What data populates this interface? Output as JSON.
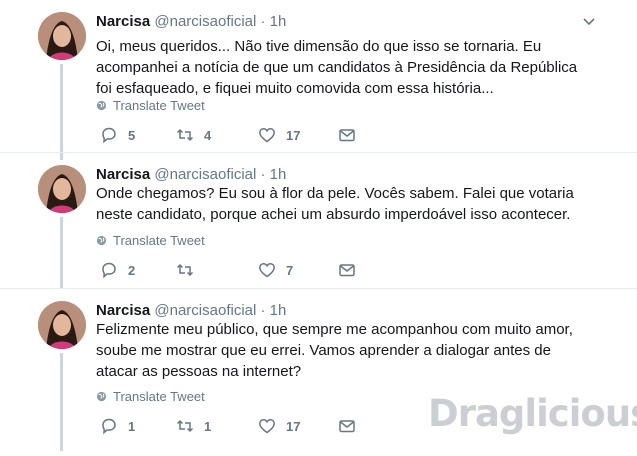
{
  "tweets": [
    {
      "name": "Narcisa",
      "handle": "@narcisaoficial",
      "dot": "·",
      "time": "1h",
      "text": "Oi, meus queridos... Não tive dimensão do que isso se tornaria. Eu acompanhei a notícia de que um candidatos à Presidência da República foi esfaqueado, e fiquei muito comovida com essa história...",
      "translate": "Translate Tweet",
      "replies": "5",
      "retweets": "4",
      "likes": "17"
    },
    {
      "name": "Narcisa",
      "handle": "@narcisaoficial",
      "dot": "·",
      "time": "1h",
      "text": "Onde chegamos? Eu sou à flor da pele. Vocês sabem. Falei que votaria neste candidato, porque achei um absurdo imperdoável isso acontecer.",
      "translate": "Translate Tweet",
      "replies": "2",
      "retweets": "",
      "likes": "7"
    },
    {
      "name": "Narcisa",
      "handle": "@narcisaoficial",
      "dot": "·",
      "time": "1h",
      "text": "Felizmente meu público, que sempre me acompanhou com muito amor, soube me mostrar que eu errei. Vamos aprender a dialogar antes de atacar as pessoas na internet?",
      "translate": "Translate Tweet",
      "replies": "1",
      "retweets": "1",
      "likes": "17"
    }
  ],
  "watermark": "Draglicious",
  "colors": {
    "text": "#14171a",
    "muted": "#657786",
    "divider": "#e6ecf0",
    "thread": "#ccd6dd"
  }
}
